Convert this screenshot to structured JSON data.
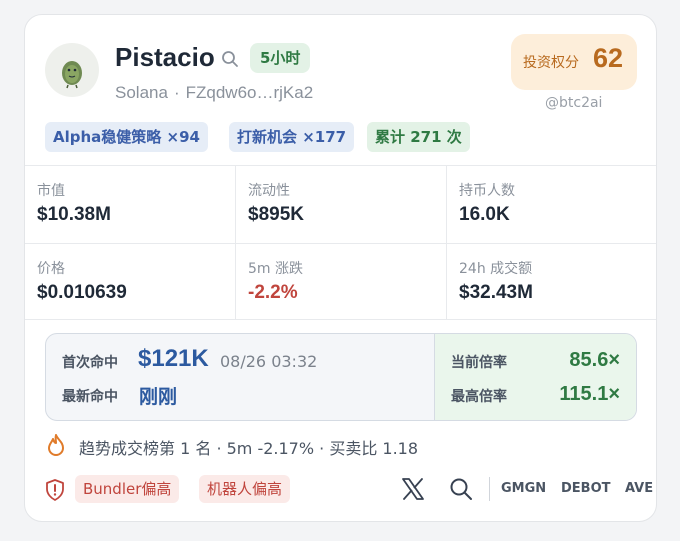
{
  "token": {
    "name": "Pistacio",
    "age_badge": "5小时",
    "chain": "Solana",
    "separator": "·",
    "address": "FZqdw6o…rjKa2"
  },
  "score": {
    "label": "投资权分",
    "value": "62"
  },
  "handle": "@btc2ai",
  "tags": [
    {
      "label": "Alpha稳健策略 ×94",
      "tone": "blue"
    },
    {
      "label": "打新机会 ×177",
      "tone": "blue"
    },
    {
      "label": "累计 271 次",
      "tone": "green"
    }
  ],
  "stats": [
    {
      "label": "市值",
      "value": "$10.38M"
    },
    {
      "label": "流动性",
      "value": "$895K"
    },
    {
      "label": "持币人数",
      "value": "16.0K"
    },
    {
      "label": "价格",
      "value": "$0.010639"
    },
    {
      "label": "5m 涨跌",
      "value": "-2.2%"
    },
    {
      "label": "24h 成交额",
      "value": "$32.43M"
    }
  ],
  "hits": {
    "first_label": "首次命中",
    "first_amount": "$121K",
    "first_time": "08/26 03:32",
    "last_label": "最新命中",
    "last_value": "刚刚",
    "current_mult_label": "当前倍率",
    "current_mult": "85.6×",
    "max_mult_label": "最高倍率",
    "max_mult": "115.1×"
  },
  "trend": "趋势成交榜第 1 名 · 5m -2.17% · 买卖比 1.18",
  "warnings": [
    "Bundler偏高",
    "机器人偏高"
  ],
  "links": [
    "GMGN",
    "DEBOT",
    "AVE"
  ],
  "colors": {
    "accent_green": "#2f7a43",
    "accent_blue": "#2c5aa0",
    "score_orange": "#b86a1f",
    "negative_red": "#c0453d"
  },
  "icons": [
    "avatar-icon",
    "search-icon",
    "fire-icon",
    "shield-alert-icon",
    "x-icon"
  ]
}
